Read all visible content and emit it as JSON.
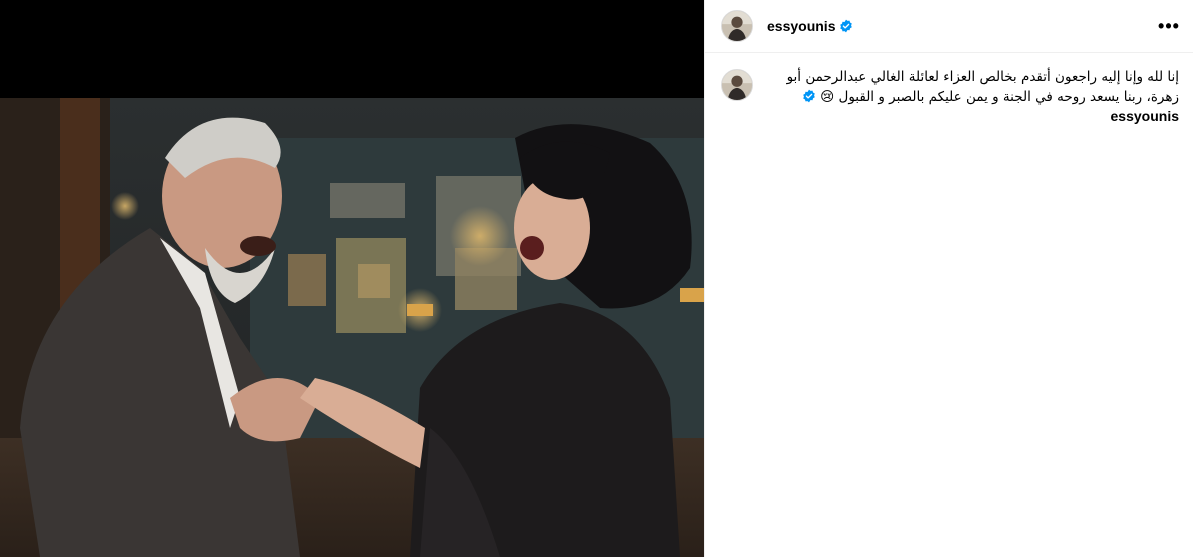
{
  "post": {
    "username": "essyounis",
    "verified": true,
    "more_options_label": "•••",
    "caption": "إنا لله وإنا إليه راجعون أتقدم بخالص العزاء لعائلة الغالي عبدالرحمن أبو زهرة، ربنا يسعد روحه في الجنة و يمن عليكم بالصبر و القبول 😢"
  },
  "icons": {
    "verified": "verified-badge-icon",
    "more": "more-options-icon"
  },
  "colors": {
    "verified_blue": "#0095f6",
    "divider": "#efefef",
    "media_bg": "#000000"
  }
}
